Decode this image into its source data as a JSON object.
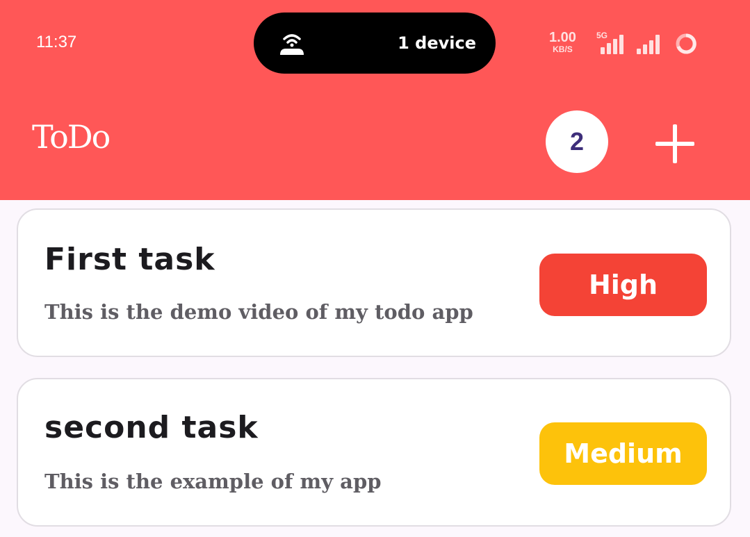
{
  "status_bar": {
    "time": "11:37",
    "island_label": "1 device",
    "island_icon": "hotspot-router-icon",
    "speed_value": "1.00",
    "speed_unit": "KB/S",
    "network_type": "5G",
    "signal_icon": "cell-signal-icon",
    "battery_icon": "battery-ring-icon"
  },
  "app_bar": {
    "title": "ToDo",
    "task_count": "2",
    "add_icon": "plus-icon",
    "background_color": "#ff5757"
  },
  "tasks": [
    {
      "title": "First task",
      "description": "This is the demo video of my todo app",
      "priority": "High",
      "priority_color": "#f44336"
    },
    {
      "title": "second task",
      "description": "This is the example of my app",
      "priority": "Medium",
      "priority_color": "#fdc20b"
    }
  ]
}
